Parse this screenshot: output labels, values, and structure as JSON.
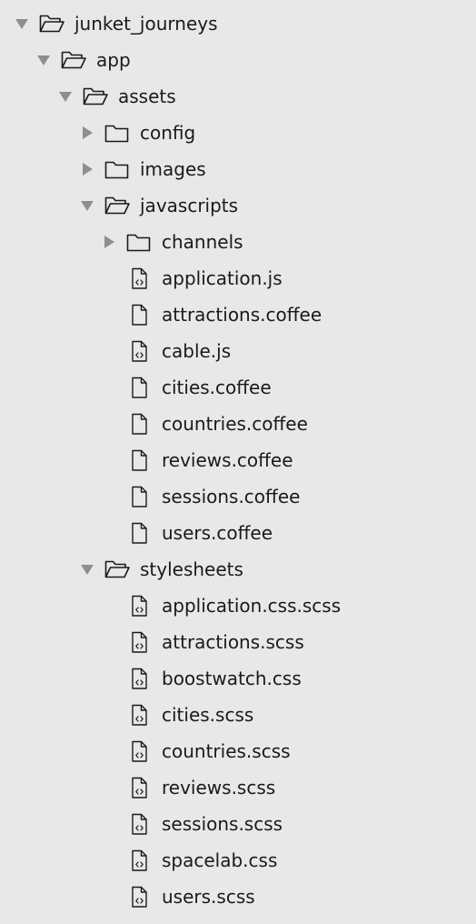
{
  "colors": {
    "background": "#e8e8e8",
    "text": "#1a1a1a",
    "icon_stroke": "#1a1a1a",
    "arrow": "#8e8e8e"
  },
  "tree": {
    "nodes": [
      {
        "label": "junket_journeys",
        "type": "folder",
        "state": "expanded",
        "icon": "folder-open-icon",
        "depth": 0
      },
      {
        "label": "app",
        "type": "folder",
        "state": "expanded",
        "icon": "folder-open-icon",
        "depth": 1
      },
      {
        "label": "assets",
        "type": "folder",
        "state": "expanded",
        "icon": "folder-open-icon",
        "depth": 2
      },
      {
        "label": "config",
        "type": "folder",
        "state": "collapsed",
        "icon": "folder-icon",
        "depth": 3
      },
      {
        "label": "images",
        "type": "folder",
        "state": "collapsed",
        "icon": "folder-icon",
        "depth": 3
      },
      {
        "label": "javascripts",
        "type": "folder",
        "state": "expanded",
        "icon": "folder-open-icon",
        "depth": 3
      },
      {
        "label": "channels",
        "type": "folder",
        "state": "collapsed",
        "icon": "folder-icon",
        "depth": 4
      },
      {
        "label": "application.js",
        "type": "file",
        "icon": "code-file-icon",
        "depth": 4
      },
      {
        "label": "attractions.coffee",
        "type": "file",
        "icon": "file-icon",
        "depth": 4
      },
      {
        "label": "cable.js",
        "type": "file",
        "icon": "code-file-icon",
        "depth": 4
      },
      {
        "label": "cities.coffee",
        "type": "file",
        "icon": "file-icon",
        "depth": 4
      },
      {
        "label": "countries.coffee",
        "type": "file",
        "icon": "file-icon",
        "depth": 4
      },
      {
        "label": "reviews.coffee",
        "type": "file",
        "icon": "file-icon",
        "depth": 4
      },
      {
        "label": "sessions.coffee",
        "type": "file",
        "icon": "file-icon",
        "depth": 4
      },
      {
        "label": "users.coffee",
        "type": "file",
        "icon": "file-icon",
        "depth": 4
      },
      {
        "label": "stylesheets",
        "type": "folder",
        "state": "expanded",
        "icon": "folder-open-icon",
        "depth": 3
      },
      {
        "label": "application.css.scss",
        "type": "file",
        "icon": "code-file-icon",
        "depth": 4
      },
      {
        "label": "attractions.scss",
        "type": "file",
        "icon": "code-file-icon",
        "depth": 4
      },
      {
        "label": "boostwatch.css",
        "type": "file",
        "icon": "code-file-icon",
        "depth": 4
      },
      {
        "label": "cities.scss",
        "type": "file",
        "icon": "code-file-icon",
        "depth": 4
      },
      {
        "label": "countries.scss",
        "type": "file",
        "icon": "code-file-icon",
        "depth": 4
      },
      {
        "label": "reviews.scss",
        "type": "file",
        "icon": "code-file-icon",
        "depth": 4
      },
      {
        "label": "sessions.scss",
        "type": "file",
        "icon": "code-file-icon",
        "depth": 4
      },
      {
        "label": "spacelab.css",
        "type": "file",
        "icon": "code-file-icon",
        "depth": 4
      },
      {
        "label": "users.scss",
        "type": "file",
        "icon": "code-file-icon",
        "depth": 4
      }
    ]
  }
}
